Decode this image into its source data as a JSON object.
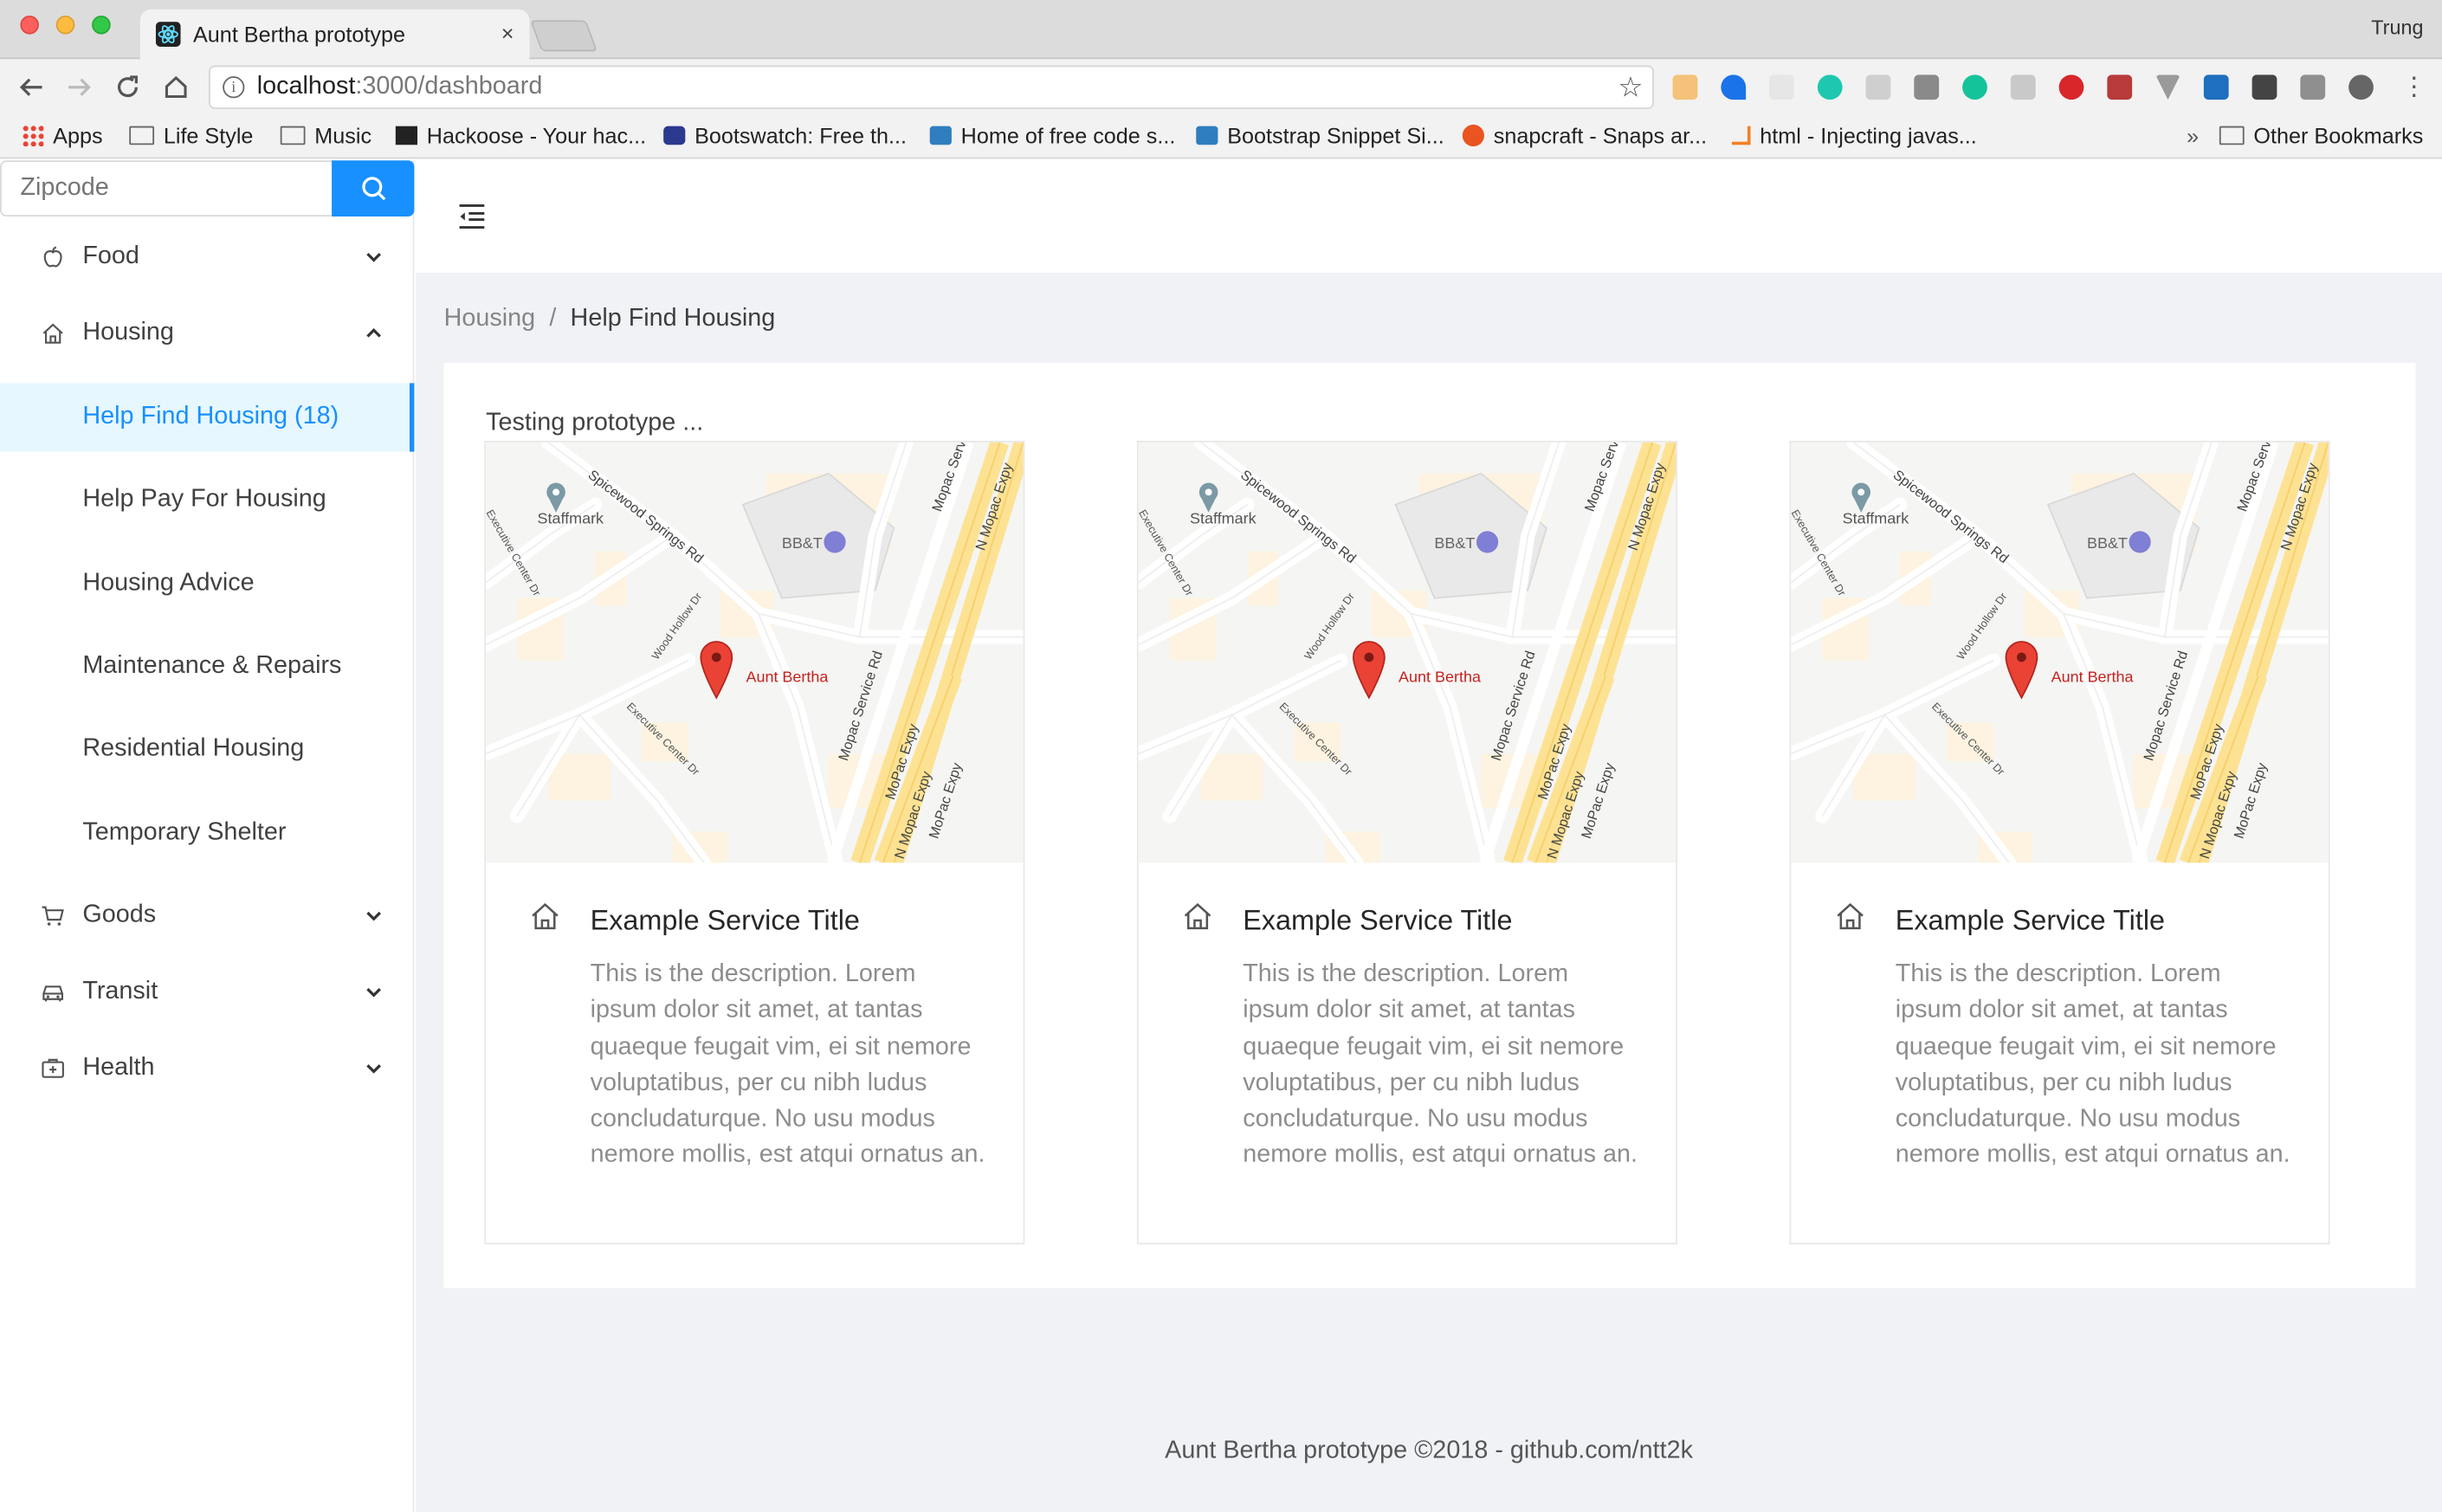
{
  "browser": {
    "tab_title": "Aunt Bertha prototype",
    "tab_close": "×",
    "user_name": "Trung",
    "url_host": "localhost",
    "url_path": ":3000/dashboard",
    "bookmarks": [
      {
        "label": "Apps",
        "icon": "apps-grid-icon"
      },
      {
        "label": "Life Style",
        "icon": "folder-icon"
      },
      {
        "label": "Music",
        "icon": "folder-icon"
      },
      {
        "label": "Hackoose - Your hac...",
        "icon": "hackoose-icon"
      },
      {
        "label": "Bootswatch: Free th...",
        "icon": "bootswatch-icon"
      },
      {
        "label": "Home of free code s...",
        "icon": "bootstrap-icon"
      },
      {
        "label": "Bootstrap Snippet Si...",
        "icon": "bootstrap-icon"
      },
      {
        "label": "snapcraft - Snaps ar...",
        "icon": "snapcraft-icon"
      },
      {
        "label": "html - Injecting javas...",
        "icon": "stackoverflow-icon"
      }
    ],
    "bookmarks_overflow": "»",
    "other_bookmarks": "Other Bookmarks"
  },
  "sidebar": {
    "search_placeholder": "Zipcode",
    "food": "Food",
    "housing": "Housing",
    "housing_items": [
      "Help Find Housing (18)",
      "Help Pay For Housing",
      "Housing Advice",
      "Maintenance & Repairs",
      "Residential Housing",
      "Temporary Shelter"
    ],
    "goods": "Goods",
    "transit": "Transit",
    "health": "Health"
  },
  "breadcrumb": {
    "parent": "Housing",
    "separator": "/",
    "current": "Help Find Housing"
  },
  "content": {
    "intro": "Testing prototype ...",
    "cards": [
      {
        "title": "Example Service Title",
        "description": "This is the description. Lorem ipsum dolor sit amet, at tantas quaeque feugait vim, ei sit nemore voluptatibus, per cu nibh ludus concludaturque. No usu modus nemore mollis, est atqui ornatus an."
      },
      {
        "title": "Example Service Title",
        "description": "This is the description. Lorem ipsum dolor sit amet, at tantas quaeque feugait vim, ei sit nemore voluptatibus, per cu nibh ludus concludaturque. No usu modus nemore mollis, est atqui ornatus an."
      },
      {
        "title": "Example Service Title",
        "description": "This is the description. Lorem ipsum dolor sit amet, at tantas quaeque feugait vim, ei sit nemore voluptatibus, per cu nibh ludus concludaturque. No usu modus nemore mollis, est atqui ornatus an."
      }
    ],
    "map": {
      "pin_label": "Aunt Bertha",
      "poi_staffmark": "Staffmark",
      "poi_bbt": "BB&T",
      "road_spicewood": "Spicewood Springs Rd",
      "road_mopac_service": "Mopac Service Rd",
      "road_n_mopac": "N Mopac Expy",
      "road_mopac_expy": "MoPac Expy",
      "road_wood_hollow": "Wood Hollow Dr",
      "road_executive": "Executive Center Dr",
      "road_mopac_serv": "Mopac Serv"
    }
  },
  "footer": {
    "text": "Aunt Bertha prototype ©2018 - github.com/ntt2k"
  },
  "colors": {
    "primary": "#1890ff",
    "active_bg": "#e6f7ff",
    "layout_bg": "#f0f2f5",
    "map_pin": "#ea4335",
    "highway": "#fde293"
  }
}
